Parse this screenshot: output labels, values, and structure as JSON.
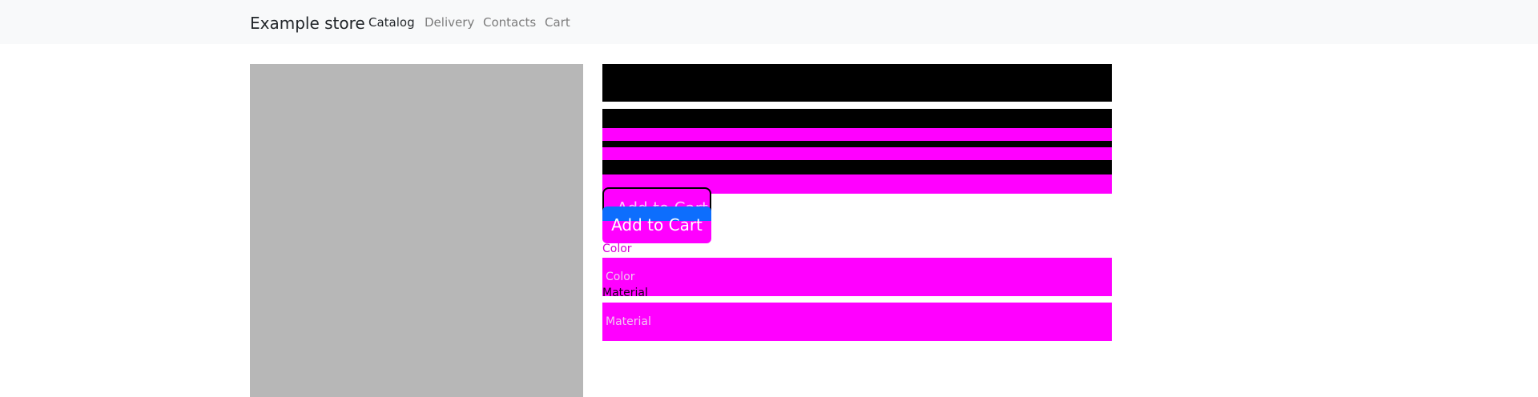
{
  "navbar": {
    "brand": "Example store",
    "links": [
      {
        "label": "Catalog",
        "active": true
      },
      {
        "label": "Delivery",
        "active": false
      },
      {
        "label": "Contacts",
        "active": false
      },
      {
        "label": "Cart",
        "active": false
      }
    ]
  },
  "product": {
    "add_to_cart_label": "Add to Cart",
    "color_label": "Color",
    "color_placeholder": "Color",
    "material_label": "Material",
    "material_placeholder": "Material"
  },
  "colors": {
    "navbar_bg": "#f8f9fa",
    "image_placeholder": "#b7b7b7",
    "masked_block": "#000000",
    "masked_highlight": "#ff00ff",
    "primary_button": "#0d6efd"
  }
}
